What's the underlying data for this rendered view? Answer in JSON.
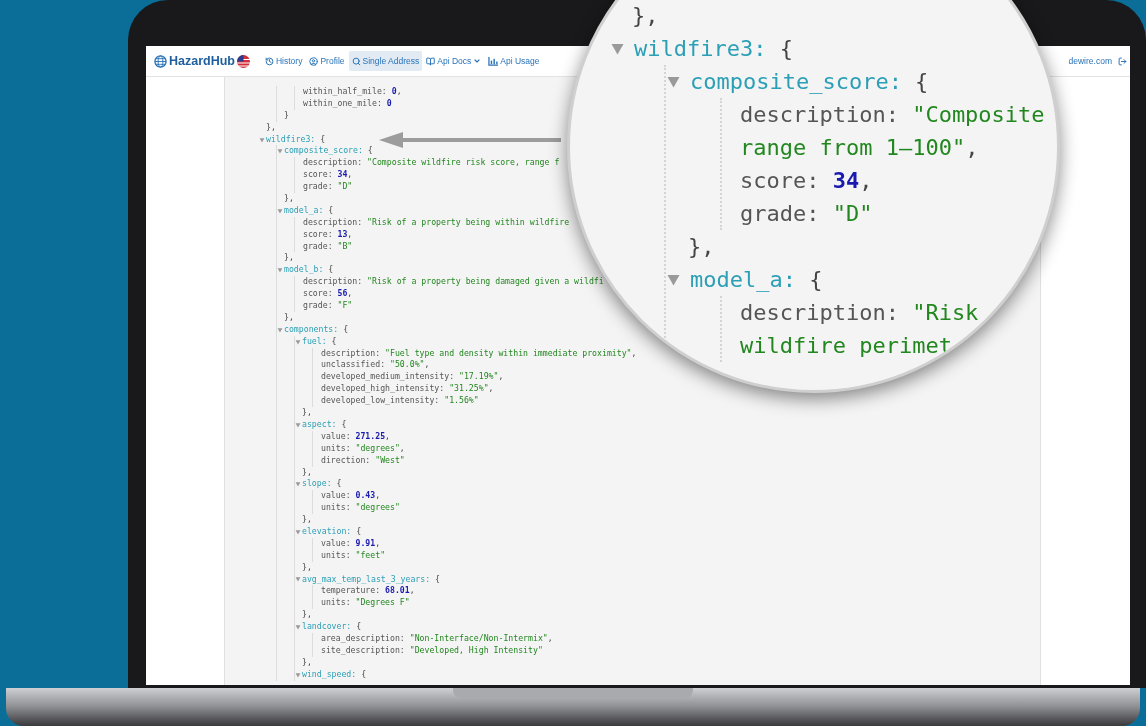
{
  "navbar": {
    "brand": "HazardHub",
    "items": [
      {
        "label": "History",
        "selected": false,
        "dropdown": false
      },
      {
        "label": "Profile",
        "selected": false,
        "dropdown": false
      },
      {
        "label": "Single Address",
        "selected": true,
        "dropdown": false
      },
      {
        "label": "Api Docs",
        "selected": false,
        "dropdown": true
      },
      {
        "label": "Api Usage",
        "selected": false,
        "dropdown": false
      }
    ],
    "user": "dewire.com"
  },
  "code": [
    {
      "close": "},",
      "children": [
        {
          "close": "}",
          "children": [
            {
              "key": "within_half_mile:",
              "value": "0",
              "kind": "number",
              "end": ","
            },
            {
              "key": "within_one_mile:",
              "value": "0",
              "kind": "number"
            }
          ]
        }
      ]
    },
    {
      "key": "wildfire3:",
      "open": "{",
      "expanded": true,
      "children": [
        {
          "key": "composite_score:",
          "open": "{",
          "close": "},",
          "expanded": true,
          "children": [
            {
              "key": "description:",
              "value": "\"Composite wildfire risk score, range f",
              "kind": "string"
            },
            {
              "key": "score:",
              "value": "34",
              "kind": "number",
              "end": ","
            },
            {
              "key": "grade:",
              "value": "\"D\"",
              "kind": "string"
            }
          ]
        },
        {
          "key": "model_a:",
          "open": "{",
          "close": "},",
          "expanded": true,
          "children": [
            {
              "key": "description:",
              "value": "\"Risk of a property being within wildfire",
              "kind": "string"
            },
            {
              "key": "score:",
              "value": "13",
              "kind": "number",
              "end": ","
            },
            {
              "key": "grade:",
              "value": "\"B\"",
              "kind": "string"
            }
          ]
        },
        {
          "key": "model_b:",
          "open": "{",
          "close": "},",
          "expanded": true,
          "children": [
            {
              "key": "description:",
              "value": "\"Risk of a property being damaged given a wildfi",
              "kind": "string"
            },
            {
              "key": "score:",
              "value": "56",
              "kind": "number",
              "end": ","
            },
            {
              "key": "grade:",
              "value": "\"F\"",
              "kind": "string"
            }
          ]
        },
        {
          "key": "components:",
          "open": "{",
          "expanded": true,
          "children": [
            {
              "key": "fuel:",
              "open": "{",
              "close": "},",
              "expanded": true,
              "children": [
                {
                  "key": "description:",
                  "value": "\"Fuel type and density within immediate proximity\"",
                  "kind": "string",
                  "end": ","
                },
                {
                  "key": "unclassified:",
                  "value": "\"50.0%\"",
                  "kind": "string",
                  "end": ","
                },
                {
                  "key": "developed_medium_intensity:",
                  "value": "\"17.19%\"",
                  "kind": "string",
                  "end": ","
                },
                {
                  "key": "developed_high_intensity:",
                  "value": "\"31.25%\"",
                  "kind": "string",
                  "end": ","
                },
                {
                  "key": "developed_low_intensity:",
                  "value": "\"1.56%\"",
                  "kind": "string"
                }
              ]
            },
            {
              "key": "aspect:",
              "open": "{",
              "close": "},",
              "expanded": true,
              "children": [
                {
                  "key": "value:",
                  "value": "271.25",
                  "kind": "number",
                  "end": ","
                },
                {
                  "key": "units:",
                  "value": "\"degrees\"",
                  "kind": "string",
                  "end": ","
                },
                {
                  "key": "direction:",
                  "value": "\"West\"",
                  "kind": "string"
                }
              ]
            },
            {
              "key": "slope:",
              "open": "{",
              "close": "},",
              "expanded": true,
              "children": [
                {
                  "key": "value:",
                  "value": "0.43",
                  "kind": "number",
                  "end": ","
                },
                {
                  "key": "units:",
                  "value": "\"degrees\"",
                  "kind": "string"
                }
              ]
            },
            {
              "key": "elevation:",
              "open": "{",
              "close": "},",
              "expanded": true,
              "children": [
                {
                  "key": "value:",
                  "value": "9.91",
                  "kind": "number",
                  "end": ","
                },
                {
                  "key": "units:",
                  "value": "\"feet\"",
                  "kind": "string"
                }
              ]
            },
            {
              "key": "avg_max_temp_last_3_years:",
              "open": "{",
              "close": "},",
              "expanded": true,
              "children": [
                {
                  "key": "temperature:",
                  "value": "68.01",
                  "kind": "number",
                  "end": ","
                },
                {
                  "key": "units:",
                  "value": "\"Degrees F\"",
                  "kind": "string"
                }
              ]
            },
            {
              "key": "landcover:",
              "open": "{",
              "close": "},",
              "expanded": true,
              "children": [
                {
                  "key": "area_description:",
                  "value": "\"Non-Interface/Non-Intermix\"",
                  "kind": "string",
                  "end": ","
                },
                {
                  "key": "site_description:",
                  "value": "\"Developed, High Intensity\"",
                  "kind": "string"
                }
              ]
            },
            {
              "key": "wind_speed:",
              "open": "{",
              "expanded": true
            }
          ]
        }
      ]
    }
  ],
  "magnifier": [
    {
      "close": "},"
    },
    {
      "key": "wildfire3:",
      "open": "{",
      "expanded": true,
      "children": [
        {
          "key": "composite_score:",
          "open": "{",
          "close": "},",
          "expanded": true,
          "children": [
            {
              "key": "description:",
              "value_lines": [
                "\"Composite",
                "range from 1–100\""
              ],
              "kind": "string",
              "end": ","
            },
            {
              "key": "score:",
              "value": "34",
              "kind": "number",
              "end": ","
            },
            {
              "key": "grade:",
              "value": "\"D\"",
              "kind": "string"
            }
          ]
        },
        {
          "key": "model_a:",
          "open": "{",
          "expanded": true,
          "children": [
            {
              "key": "description:",
              "value_lines": [
                "\"Risk",
                "wildfire perimet"
              ],
              "kind": "string"
            }
          ]
        }
      ]
    }
  ]
}
